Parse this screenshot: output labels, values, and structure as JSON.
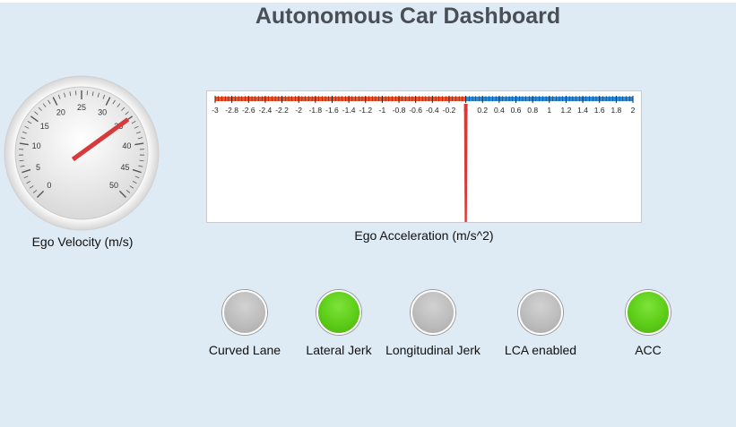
{
  "title": "Autonomous Car Dashboard",
  "velocity": {
    "label": "Ego Velocity (m/s)",
    "min": 0,
    "max": 50,
    "value": 35,
    "tick_labels": [
      "0",
      "5",
      "10",
      "15",
      "20",
      "25",
      "30",
      "35",
      "40",
      "45",
      "50"
    ],
    "needle_color": "#d73a3a"
  },
  "acceleration": {
    "label": "Ego Acceleration (m/s^2)",
    "min": -3,
    "max": 2,
    "value": 0,
    "tick_labels": [
      "-3",
      "-2.8",
      "-2.6",
      "-2.4",
      "-2.2",
      "-2",
      "-1.8",
      "-1.6",
      "-1.4",
      "-1.2",
      "-1",
      "-0.8",
      "-0.6",
      "-0.4",
      "-0.2",
      "0",
      "0.2",
      "0.4",
      "0.6",
      "0.8",
      "1",
      "1.2",
      "1.4",
      "1.6",
      "1.8",
      "2"
    ],
    "negative_color": "#f0542e",
    "positive_color": "#2a8de0",
    "needle_color": "#d73a3a"
  },
  "lamps": [
    {
      "label": "Curved Lane",
      "on": false
    },
    {
      "label": "Lateral Jerk",
      "on": true
    },
    {
      "label": "Longitudinal Jerk",
      "on": false
    },
    {
      "label": "LCA enabled",
      "on": false
    },
    {
      "label": "ACC",
      "on": true
    }
  ],
  "colors": {
    "lamp_on": "#5ccd17",
    "lamp_off": "#bdbdbd",
    "background": "#deeaf4"
  }
}
